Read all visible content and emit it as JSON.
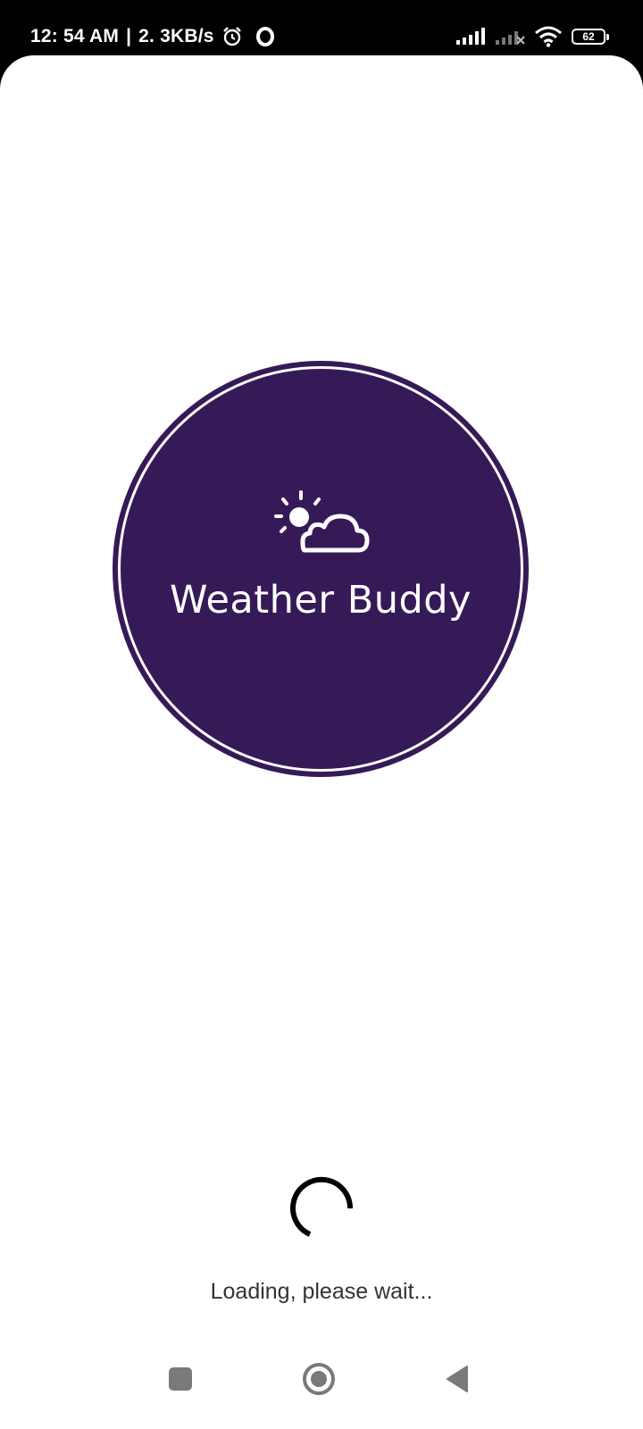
{
  "status_bar": {
    "time": "12: 54 AM",
    "separator": "|",
    "network_speed": "2. 3KB/s",
    "battery_level": "62",
    "icons": [
      "alarm-icon",
      "opera-icon",
      "signal-icon",
      "signal-no-service-icon",
      "wifi-icon",
      "battery-icon"
    ]
  },
  "app": {
    "name": "Weather Buddy",
    "logo_icon": "partly-cloudy-icon",
    "loading_text": "Loading, please wait...",
    "colors": {
      "logo_bg": "#361a58",
      "logo_fg": "#ffffff",
      "spinner": "#000000",
      "background": "#ffffff"
    }
  },
  "nav_bar": {
    "buttons": [
      "recents-square-icon",
      "home-circle-icon",
      "back-triangle-icon"
    ]
  }
}
